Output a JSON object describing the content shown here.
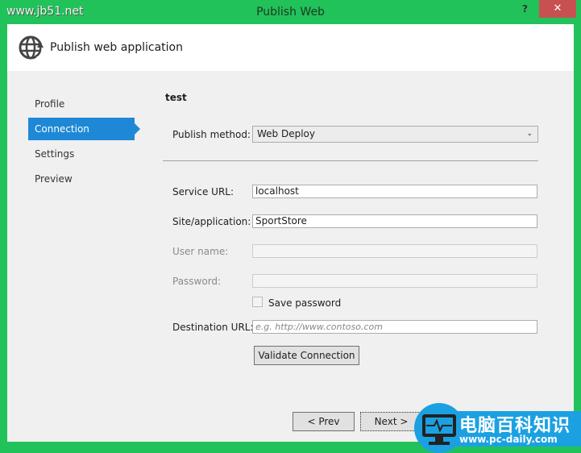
{
  "window": {
    "title": "Publish Web",
    "help": "?",
    "close": "✕",
    "watermark_top": "www.jb51.net"
  },
  "header": {
    "title": "Publish web application",
    "icon": "globe-publish-icon"
  },
  "nav": {
    "items": [
      {
        "label": "Profile"
      },
      {
        "label": "Connection",
        "selected": true
      },
      {
        "label": "Settings"
      },
      {
        "label": "Preview"
      }
    ]
  },
  "profile_name": "test",
  "form": {
    "publish_method": {
      "label": "Publish method:",
      "value": "Web Deploy"
    },
    "service_url": {
      "label": "Service URL:",
      "value": "localhost"
    },
    "site_app": {
      "label": "Site/application:",
      "value": "SportStore"
    },
    "user_name": {
      "label": "User name:",
      "value": ""
    },
    "password": {
      "label": "Password:",
      "value": ""
    },
    "save_password": {
      "label": "Save password",
      "checked": false
    },
    "destination_url": {
      "label": "Destination URL:",
      "placeholder": "e.g. http://www.contoso.com"
    },
    "validate": "Validate Connection"
  },
  "buttons": {
    "prev": "< Prev",
    "next": "Next >"
  },
  "watermark_badge": {
    "title": "电脑百科知识",
    "url": "www.pc-daily.com"
  },
  "colors": {
    "titlebar": "#22c25a",
    "accent": "#1e88d6",
    "close": "#c75050"
  }
}
